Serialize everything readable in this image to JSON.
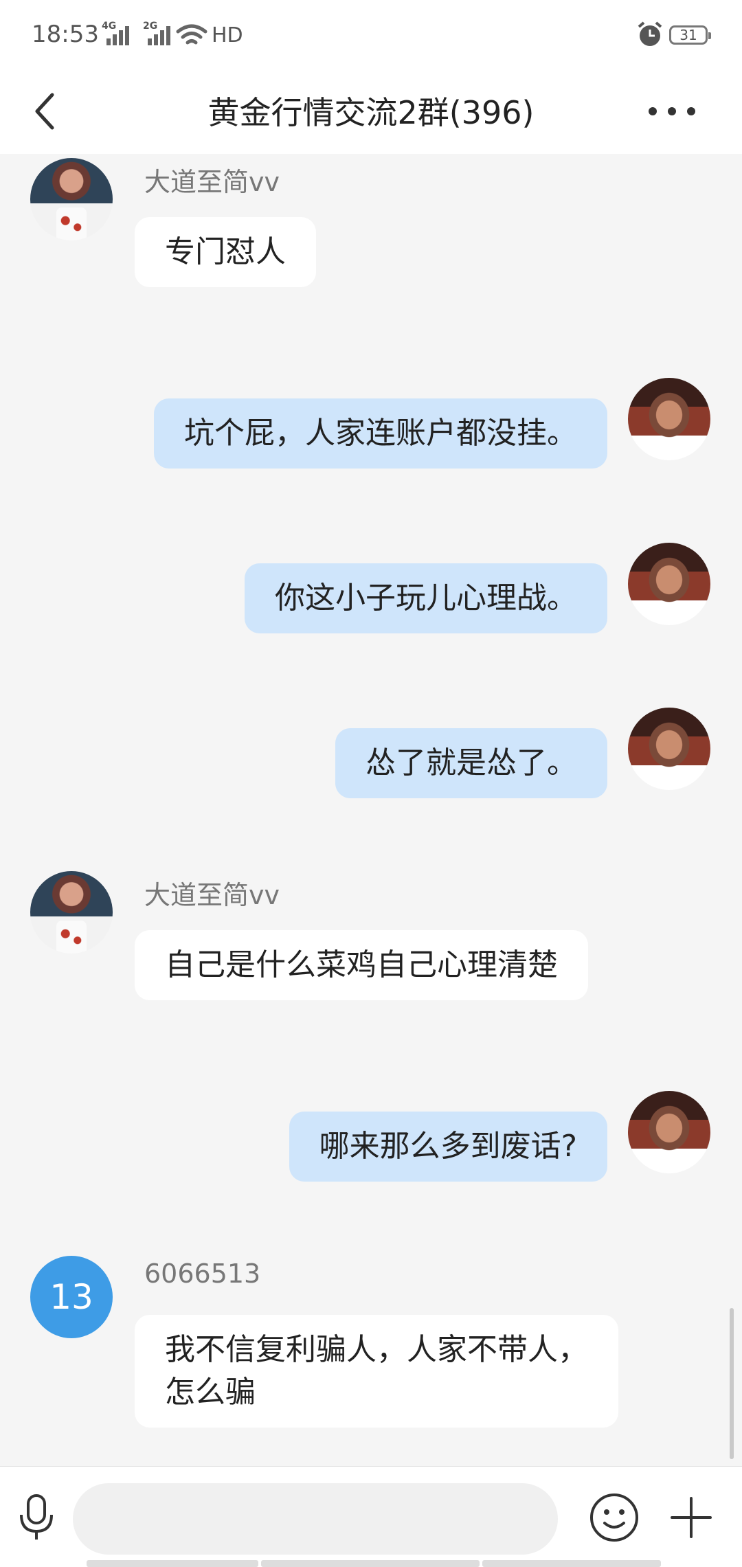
{
  "status_bar": {
    "time": "18:53",
    "net1": "4G",
    "net2": "2G",
    "hd": "HD",
    "battery": "31"
  },
  "header": {
    "title": "黄金行情交流2群(396)"
  },
  "messages": [
    {
      "side": "left",
      "nick": "大道至简vv",
      "avatar": "woman-avatar",
      "text": "专门怼人"
    },
    {
      "side": "right",
      "avatar": "man-avatar",
      "text": "坑个屁，人家连账户都没挂。"
    },
    {
      "side": "right",
      "avatar": "man-avatar",
      "text": "你这小子玩儿心理战。"
    },
    {
      "side": "right",
      "avatar": "man-avatar",
      "text": "怂了就是怂了。"
    },
    {
      "side": "left",
      "nick": "大道至简vv",
      "avatar": "woman-avatar",
      "text": "自己是什么菜鸡自己心理清楚"
    },
    {
      "side": "right",
      "avatar": "man-avatar",
      "text": "哪来那么多到废话?"
    },
    {
      "side": "left",
      "nick": "6066513",
      "avatar": "13",
      "text": "我不信复利骗人，人家不带人，怎么骗"
    }
  ],
  "input": {
    "placeholder": ""
  },
  "colors": {
    "own_bubble": "#cfe5fb",
    "other_bubble": "#ffffff",
    "background": "#f5f5f5",
    "avatar_badge": "#3e9ce6"
  }
}
